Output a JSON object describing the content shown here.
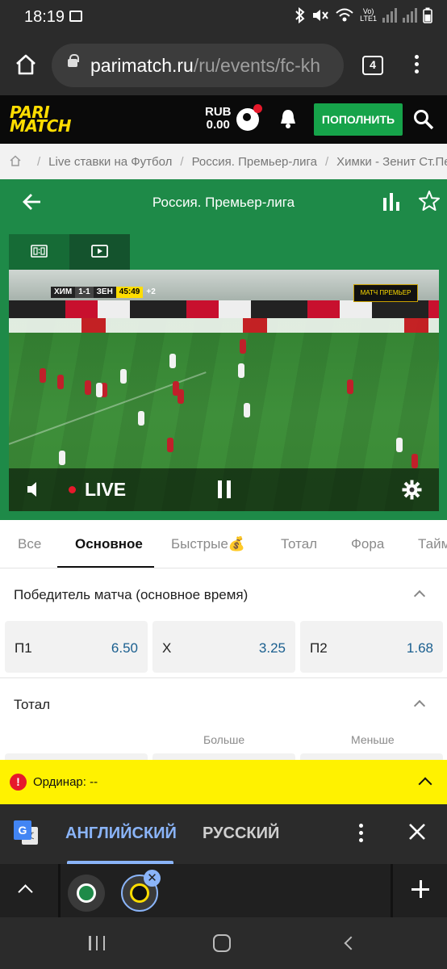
{
  "status_bar": {
    "time": "18:19",
    "network": "Vo)\nLTE1",
    "icons": [
      "image-icon",
      "bluetooth-icon",
      "mute-icon",
      "wifi-icon",
      "signal-icon",
      "signal-icon"
    ]
  },
  "browser": {
    "url_domain": "parimatch.ru",
    "url_path": "/ru/events/fc-kh",
    "tab_count": "4"
  },
  "site_header": {
    "logo_line1": "PARI",
    "logo_line2": "MATCH",
    "currency": "RUB",
    "balance": "0.00",
    "deposit_label": "ПОПОЛНИТЬ"
  },
  "breadcrumb": {
    "items": [
      "Live ставки на Футбол",
      "Россия. Премьер-лига",
      "Химки - Зенит Ст.Петербург"
    ],
    "separator": "/"
  },
  "event_header": {
    "title": "Россия. Премьер-лига"
  },
  "video": {
    "scoreboard": {
      "home": "ХИМ",
      "score": "1-1",
      "away": "ЗЕН",
      "time": "45:49",
      "added": "+2"
    },
    "ad_text": "МАТЧ ПРЕМЬЕР",
    "live_label": "LIVE"
  },
  "market_tabs": [
    {
      "label": "Все",
      "active": false
    },
    {
      "label": "Основное",
      "active": true
    },
    {
      "label": "Быстрые💰",
      "active": false
    },
    {
      "label": "Тотал",
      "active": false
    },
    {
      "label": "Фора",
      "active": false
    },
    {
      "label": "Тайм",
      "active": false
    }
  ],
  "markets": {
    "winner": {
      "title": "Победитель матча (основное время)",
      "outcomes": [
        {
          "name": "П1",
          "odds": "6.50"
        },
        {
          "name": "X",
          "odds": "3.25"
        },
        {
          "name": "П2",
          "odds": "1.68"
        }
      ]
    },
    "total": {
      "title": "Тотал",
      "col_over": "Больше",
      "col_under": "Меньше"
    }
  },
  "betslip": {
    "label": "Ординар: --",
    "warn": "!"
  },
  "translate_bar": {
    "lang_source": "АНГЛИЙСКИЙ",
    "lang_target": "РУССКИЙ",
    "source_active": true
  },
  "tab_strip": {
    "close_label": "✕"
  },
  "colors": {
    "brand_green": "#1e8a48",
    "brand_yellow": "#ffdd00",
    "deposit_green": "#16a34a",
    "odds_blue": "#1a5f8f",
    "betslip_yellow": "#fff200",
    "translate_blue": "#8ab4f8"
  }
}
